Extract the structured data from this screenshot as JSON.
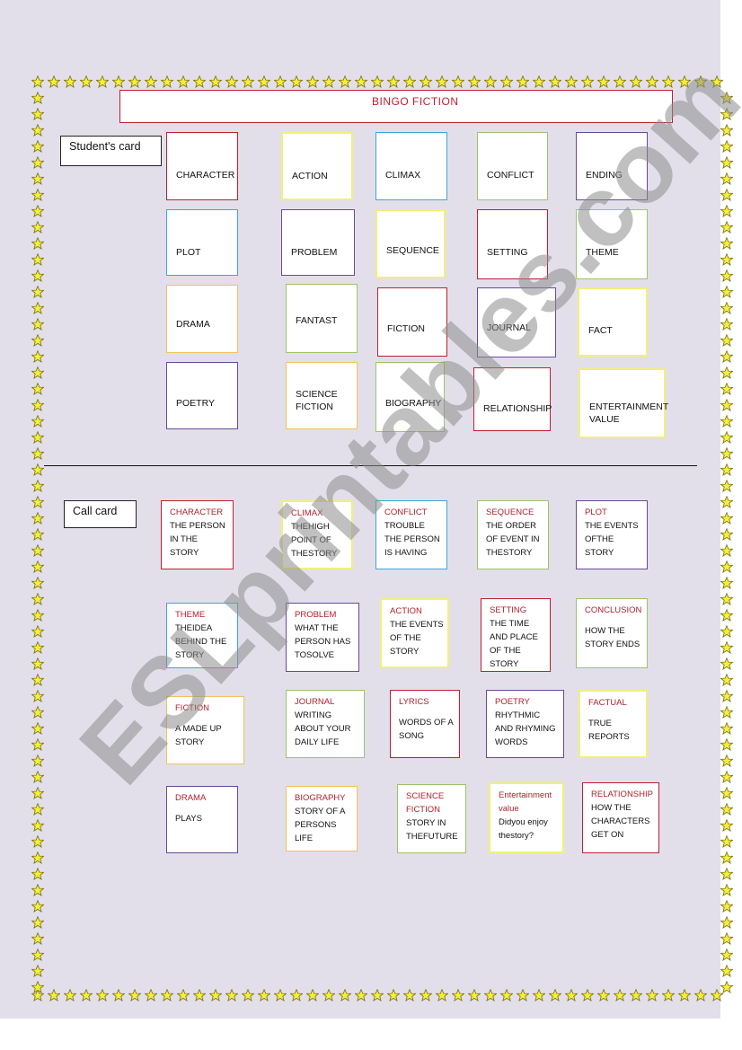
{
  "title": "BINGO  FICTION",
  "colors": {
    "red": "#c0202e",
    "yellow": "#f2f07a",
    "blue": "#3aa8d8",
    "green": "#9cc46a",
    "purple": "#6a4a96",
    "orange": "#f2c25c",
    "term": "#b0202c",
    "background": "#e2dfea",
    "star": "#f5ee3c"
  },
  "students_card": {
    "label": "Student's card",
    "cards": [
      {
        "word": "CHARACTER",
        "color": "red"
      },
      {
        "word": "ACTION",
        "color": "yellow"
      },
      {
        "word": "CLIMAX",
        "color": "blue"
      },
      {
        "word": "CONFLICT",
        "color": "green"
      },
      {
        "word": "ENDING",
        "color": "purple"
      },
      {
        "word": "PLOT",
        "color": "blue"
      },
      {
        "word": "PROBLEM",
        "color": "purple"
      },
      {
        "word": "SEQUENCE",
        "color": "yellow"
      },
      {
        "word": "SETTING",
        "color": "red"
      },
      {
        "word": "THEME",
        "color": "green"
      },
      {
        "word": "DRAMA",
        "color": "orange"
      },
      {
        "word": "FANTAST",
        "color": "green"
      },
      {
        "word": "FICTION",
        "color": "red"
      },
      {
        "word": "JOURNAL",
        "color": "purple"
      },
      {
        "word": "FACT",
        "color": "yellow"
      },
      {
        "word": "POETRY",
        "color": "purple"
      },
      {
        "word": "SCIENCE\nFICTION",
        "color": "orange"
      },
      {
        "word": "BIOGRAPHY",
        "color": "green"
      },
      {
        "word": "RELATIONSHIP",
        "color": "red"
      },
      {
        "word": "ENTERTAINMENT\nVALUE",
        "color": "yellow"
      }
    ]
  },
  "call_card": {
    "label": "Call card",
    "cards": [
      {
        "term": "CHARACTER",
        "definition": "THE PERSON\nIN THE\nSTORY",
        "color": "red"
      },
      {
        "term": "CLIMAX",
        "definition": "THEHIGH\nPOINT OF\nTHESTORY",
        "color": "yellow"
      },
      {
        "term": "CONFLICT",
        "definition": "TROUBLE\nTHE  PERSON\nIS HAVING",
        "color": "blue"
      },
      {
        "term": "SEQUENCE",
        "definition": "THE ORDER\nOF EVENT IN\nTHESTORY",
        "color": "green"
      },
      {
        "term": "PLOT",
        "definition": "THE EVENTS\nOFTHE\nSTORY",
        "color": "purple"
      },
      {
        "term": "THEME",
        "definition": "THEIDEA\nBEHIND THE\nSTORY",
        "color": "blue"
      },
      {
        "term": "PROBLEM",
        "definition": "WHAT THE\nPERSON HAS\nTOSOLVE",
        "color": "purple"
      },
      {
        "term": "ACTION",
        "definition": "THE EVENTS\nOF THE\nSTORY",
        "color": "yellow"
      },
      {
        "term": "SETTING",
        "definition": "THE TIME\nAND PLACE\nOF THE\nSTORY",
        "color": "red"
      },
      {
        "term": "CONCLUSION",
        "definition": "HOW THE\nSTORY ENDS",
        "color": "green"
      },
      {
        "term": "FICTION",
        "definition": "A MADE UP\nSTORY",
        "color": "orange"
      },
      {
        "term": "JOURNAL",
        "definition": "WRITING\nABOUT YOUR\nDAILY LIFE",
        "color": "green"
      },
      {
        "term": "LYRICS",
        "definition": "WORDS OF A\nSONG",
        "color": "red"
      },
      {
        "term": "POETRY",
        "definition": "RHYTHMIC\nAND RHYMING\nWORDS",
        "color": "purple"
      },
      {
        "term": "FACTUAL",
        "definition": "TRUE\nREPORTS",
        "color": "yellow"
      },
      {
        "term": "DRAMA",
        "definition": "PLAYS",
        "color": "purple"
      },
      {
        "term": "BIOGRAPHY",
        "definition": "STORY OF A\nPERSONS\nLIFE",
        "color": "orange"
      },
      {
        "term": "SCIENCE\nFICTION",
        "definition": "STORY IN\nTHEFUTURE",
        "color": "green"
      },
      {
        "term": "Entertainment\nvalue",
        "definition": "Didyou enjoy\nthestory?",
        "color": "yellow"
      },
      {
        "term": "RELATIONSHIP",
        "definition": "HOW THE\nCHARACTERS\nGET ON",
        "color": "red"
      }
    ]
  },
  "watermark": "ESLprintables.com"
}
